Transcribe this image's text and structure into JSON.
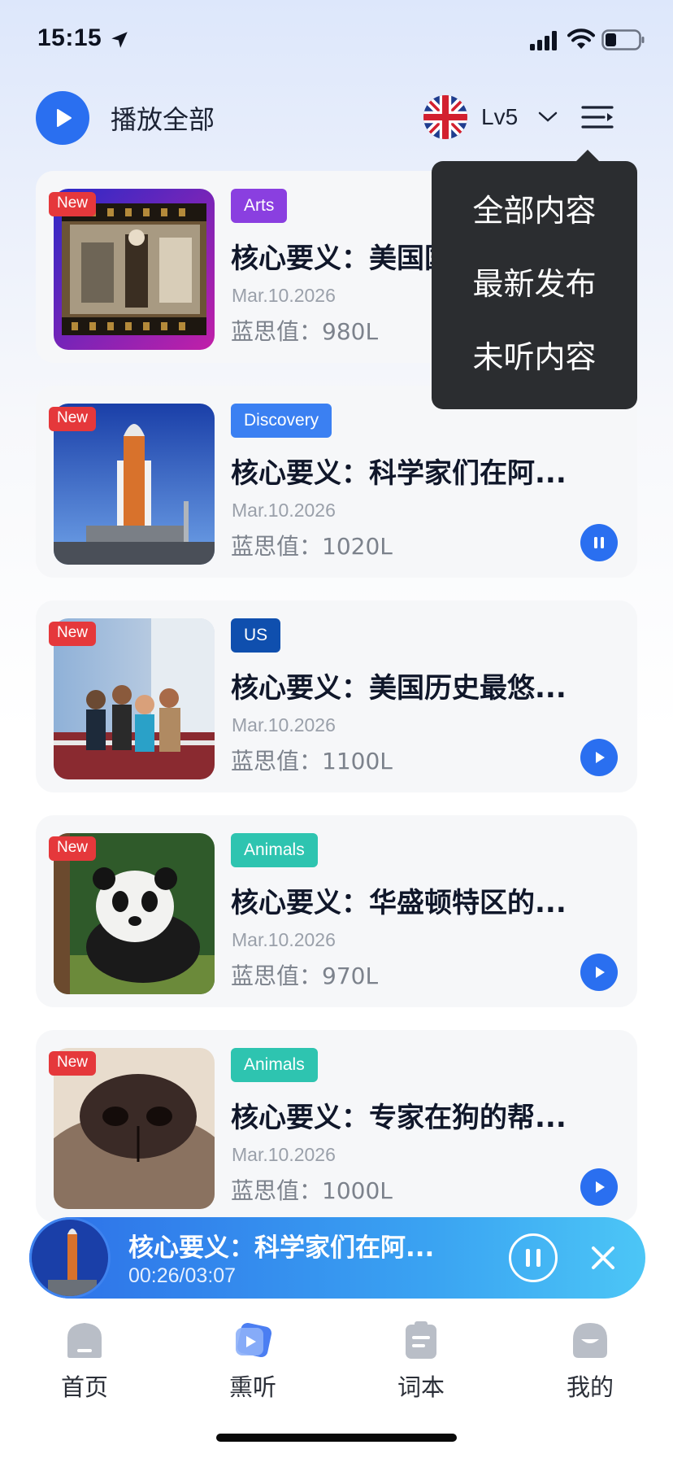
{
  "status_bar": {
    "time": "15:15"
  },
  "header": {
    "play_all_label": "播放全部",
    "level": "Lv5"
  },
  "dropdown": {
    "items": [
      "全部内容",
      "最新发布",
      "未听内容"
    ]
  },
  "articles": [
    {
      "badge": "New",
      "tag": "Arts",
      "tag_color": "#8a3fe0",
      "title": "核心要义：美国国会图书...",
      "date": "Mar.10.2026",
      "lexile": "蓝思值：980L",
      "button_state": "play"
    },
    {
      "badge": "New",
      "tag": "Discovery",
      "tag_color": "#3b80f2",
      "title": "核心要义：科学家们在阿...",
      "date": "Mar.10.2026",
      "lexile": "蓝思值：1020L",
      "button_state": "pause"
    },
    {
      "badge": "New",
      "tag": "US",
      "tag_color": "#0f4fae",
      "title": "核心要义：美国历史最悠...",
      "date": "Mar.10.2026",
      "lexile": "蓝思值：1100L",
      "button_state": "play"
    },
    {
      "badge": "New",
      "tag": "Animals",
      "tag_color": "#2ec4b0",
      "title": "核心要义：华盛顿特区的...",
      "date": "Mar.10.2026",
      "lexile": "蓝思值：970L",
      "button_state": "play"
    },
    {
      "badge": "New",
      "tag": "Animals",
      "tag_color": "#2ec4b0",
      "title": "核心要义：专家在狗的帮...",
      "date": "Mar.10.2026",
      "lexile": "蓝思值：1000L",
      "button_state": "play"
    }
  ],
  "player": {
    "title": "核心要义：科学家们在阿...",
    "time": "00:26/03:07"
  },
  "tabs": [
    {
      "label": "首页",
      "icon": "home-icon"
    },
    {
      "label": "熏听",
      "icon": "listen-icon"
    },
    {
      "label": "词本",
      "icon": "wordbook-icon"
    },
    {
      "label": "我的",
      "icon": "profile-icon"
    }
  ],
  "colors": {
    "accent": "#2a6ff0",
    "badge_red": "#e5383b",
    "dropdown_bg": "#2b2d30"
  }
}
